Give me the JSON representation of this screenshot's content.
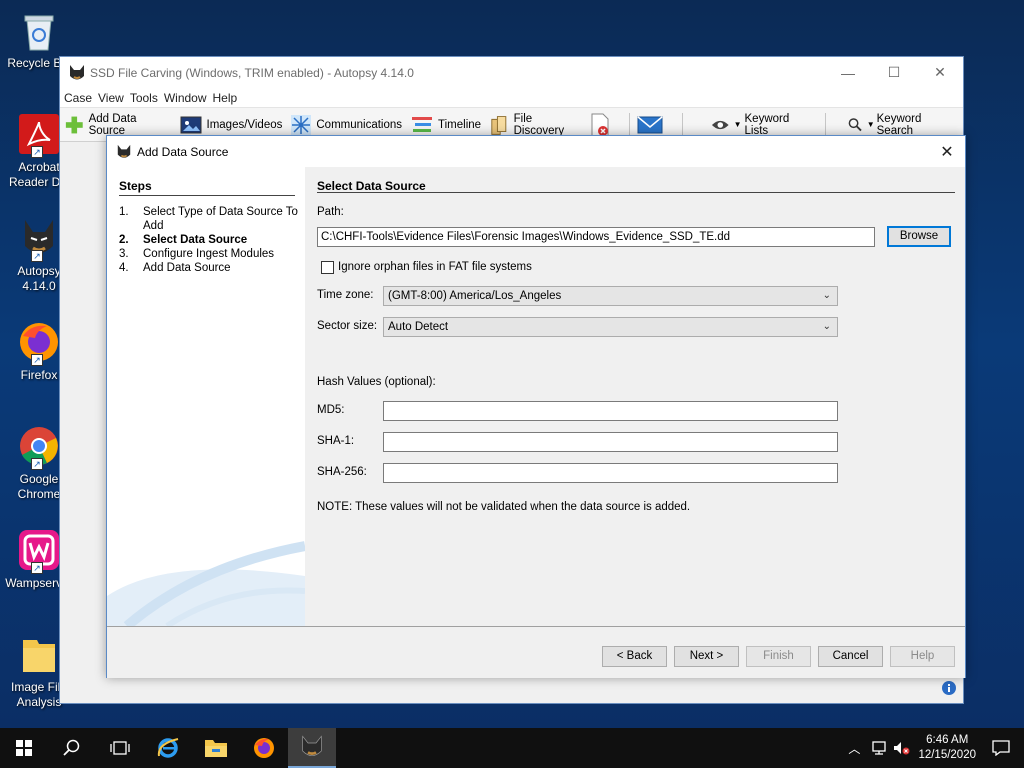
{
  "desktop": {
    "icons": [
      {
        "label": "Recycle Bin",
        "icon": "recycle-bin-icon"
      },
      {
        "label": "Acrobat Reader DC",
        "icon": "acrobat-icon"
      },
      {
        "label": "Autopsy 4.14.0",
        "icon": "autopsy-icon"
      },
      {
        "label": "Firefox",
        "icon": "firefox-icon"
      },
      {
        "label": "Google Chrome",
        "icon": "chrome-icon"
      },
      {
        "label": "Wampserver",
        "icon": "wampserver-icon"
      },
      {
        "label": "Image File Analysis",
        "icon": "folder-icon"
      }
    ]
  },
  "main_window": {
    "title": "SSD File Carving (Windows, TRIM enabled) - Autopsy 4.14.0",
    "menu": [
      "Case",
      "View",
      "Tools",
      "Window",
      "Help"
    ],
    "toolbar": {
      "add_data_source": "Add Data Source",
      "images_videos": "Images/Videos",
      "communications": "Communications",
      "timeline": "Timeline",
      "file_discovery": "File Discovery",
      "keyword_lists": "Keyword Lists",
      "keyword_search": "Keyword Search"
    }
  },
  "dialog": {
    "title": "Add Data Source",
    "steps_header": "Steps",
    "steps": [
      {
        "num": "1.",
        "label": "Select Type of Data Source To Add",
        "active": false
      },
      {
        "num": "2.",
        "label": "Select Data Source",
        "active": true
      },
      {
        "num": "3.",
        "label": "Configure Ingest Modules",
        "active": false
      },
      {
        "num": "4.",
        "label": "Add Data Source",
        "active": false
      }
    ],
    "content_header": "Select Data Source",
    "path_label": "Path:",
    "path_value": "C:\\CHFI-Tools\\Evidence Files\\Forensic Images\\Windows_Evidence_SSD_TE.dd",
    "browse_label": "Browse",
    "ignore_orphan_label": "Ignore orphan files in FAT file systems",
    "ignore_orphan_checked": false,
    "timezone_label": "Time zone:",
    "timezone_value": "(GMT-8:00) America/Los_Angeles",
    "sector_label": "Sector size:",
    "sector_value": "Auto Detect",
    "hash_header": "Hash Values (optional):",
    "md5_label": "MD5:",
    "md5_value": "",
    "sha1_label": "SHA-1:",
    "sha1_value": "",
    "sha256_label": "SHA-256:",
    "sha256_value": "",
    "note": "NOTE: These values will not be validated when the data source is added.",
    "buttons": {
      "back": "< Back",
      "next": "Next >",
      "finish": "Finish",
      "cancel": "Cancel",
      "help": "Help"
    }
  },
  "taskbar": {
    "time": "6:46 AM",
    "date": "12/15/2020"
  },
  "colors": {
    "accent": "#0078d7",
    "desktop_bg": "#0a3a78"
  }
}
